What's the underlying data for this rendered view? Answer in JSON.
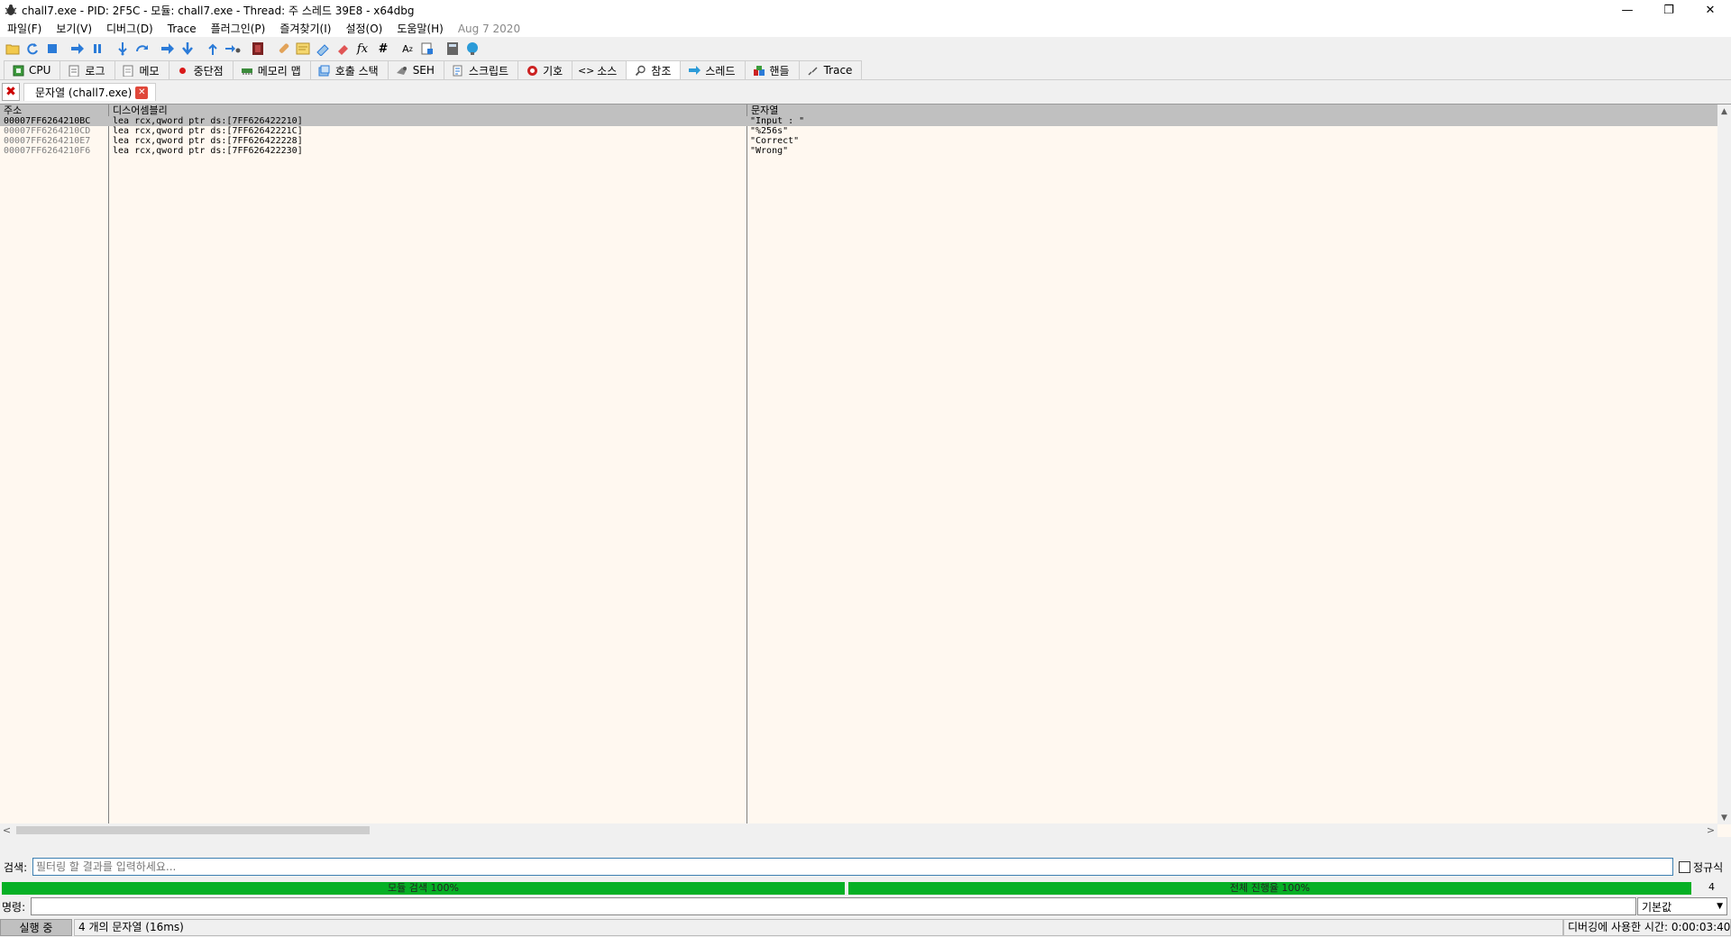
{
  "window": {
    "title": "chall7.exe - PID: 2F5C - 모듈: chall7.exe - Thread: 주 스레드 39E8 - x64dbg",
    "icon": "bug-icon"
  },
  "menu": {
    "items": [
      "파일(F)",
      "보기(V)",
      "디버그(D)",
      "Trace",
      "플러그인(P)",
      "즐겨찾기(I)",
      "설정(O)",
      "도움말(H)"
    ],
    "date": "Aug 7 2020"
  },
  "tabs": [
    {
      "label": "CPU",
      "icon": "cpu-icon"
    },
    {
      "label": "로그",
      "icon": "log-icon"
    },
    {
      "label": "메모",
      "icon": "notes-icon"
    },
    {
      "label": "중단점",
      "icon": "breakpoint-icon"
    },
    {
      "label": "메모리 맵",
      "icon": "memory-map-icon"
    },
    {
      "label": "호출 스택",
      "icon": "call-stack-icon"
    },
    {
      "label": "SEH",
      "icon": "seh-icon"
    },
    {
      "label": "스크립트",
      "icon": "script-icon"
    },
    {
      "label": "기호",
      "icon": "symbols-icon"
    },
    {
      "label": "소스",
      "icon": "source-icon"
    },
    {
      "label": "참조",
      "icon": "references-icon",
      "active": true
    },
    {
      "label": "스레드",
      "icon": "threads-icon"
    },
    {
      "label": "핸들",
      "icon": "handles-icon"
    },
    {
      "label": "Trace",
      "icon": "trace-icon"
    }
  ],
  "subtab": {
    "label": "문자열 (chall7.exe)"
  },
  "columns": {
    "address": "주소",
    "disassembly": "디스어셈블리",
    "string": "문자열"
  },
  "rows": [
    {
      "address": "00007FF6264210BC",
      "disassembly": "lea rcx,qword ptr ds:[7FF626422210]",
      "string": "\"Input : \"",
      "selected": true
    },
    {
      "address": "00007FF6264210CD",
      "disassembly": "lea rcx,qword ptr ds:[7FF62642221C]",
      "string": "\"%256s\""
    },
    {
      "address": "00007FF6264210E7",
      "disassembly": "lea rcx,qword ptr ds:[7FF626422228]",
      "string": "\"Correct\""
    },
    {
      "address": "00007FF6264210F6",
      "disassembly": "lea rcx,qword ptr ds:[7FF626422230]",
      "string": "\"Wrong\""
    }
  ],
  "search": {
    "label": "검색:",
    "placeholder": "필터링 할 결과를 입력하세요...",
    "regex_label": "정규식"
  },
  "progress": {
    "module_label": "모듈 검색 100%",
    "module_value": 100,
    "total_label": "전체 진행율 100%",
    "total_value": 100,
    "count": "4"
  },
  "command": {
    "label": "명령:",
    "mode": "기본값"
  },
  "status": {
    "state": "실행 중",
    "message": "4 개의 문자열 (16ms)",
    "time": "디버깅에 사용한 시간: 0:00:03:40"
  }
}
